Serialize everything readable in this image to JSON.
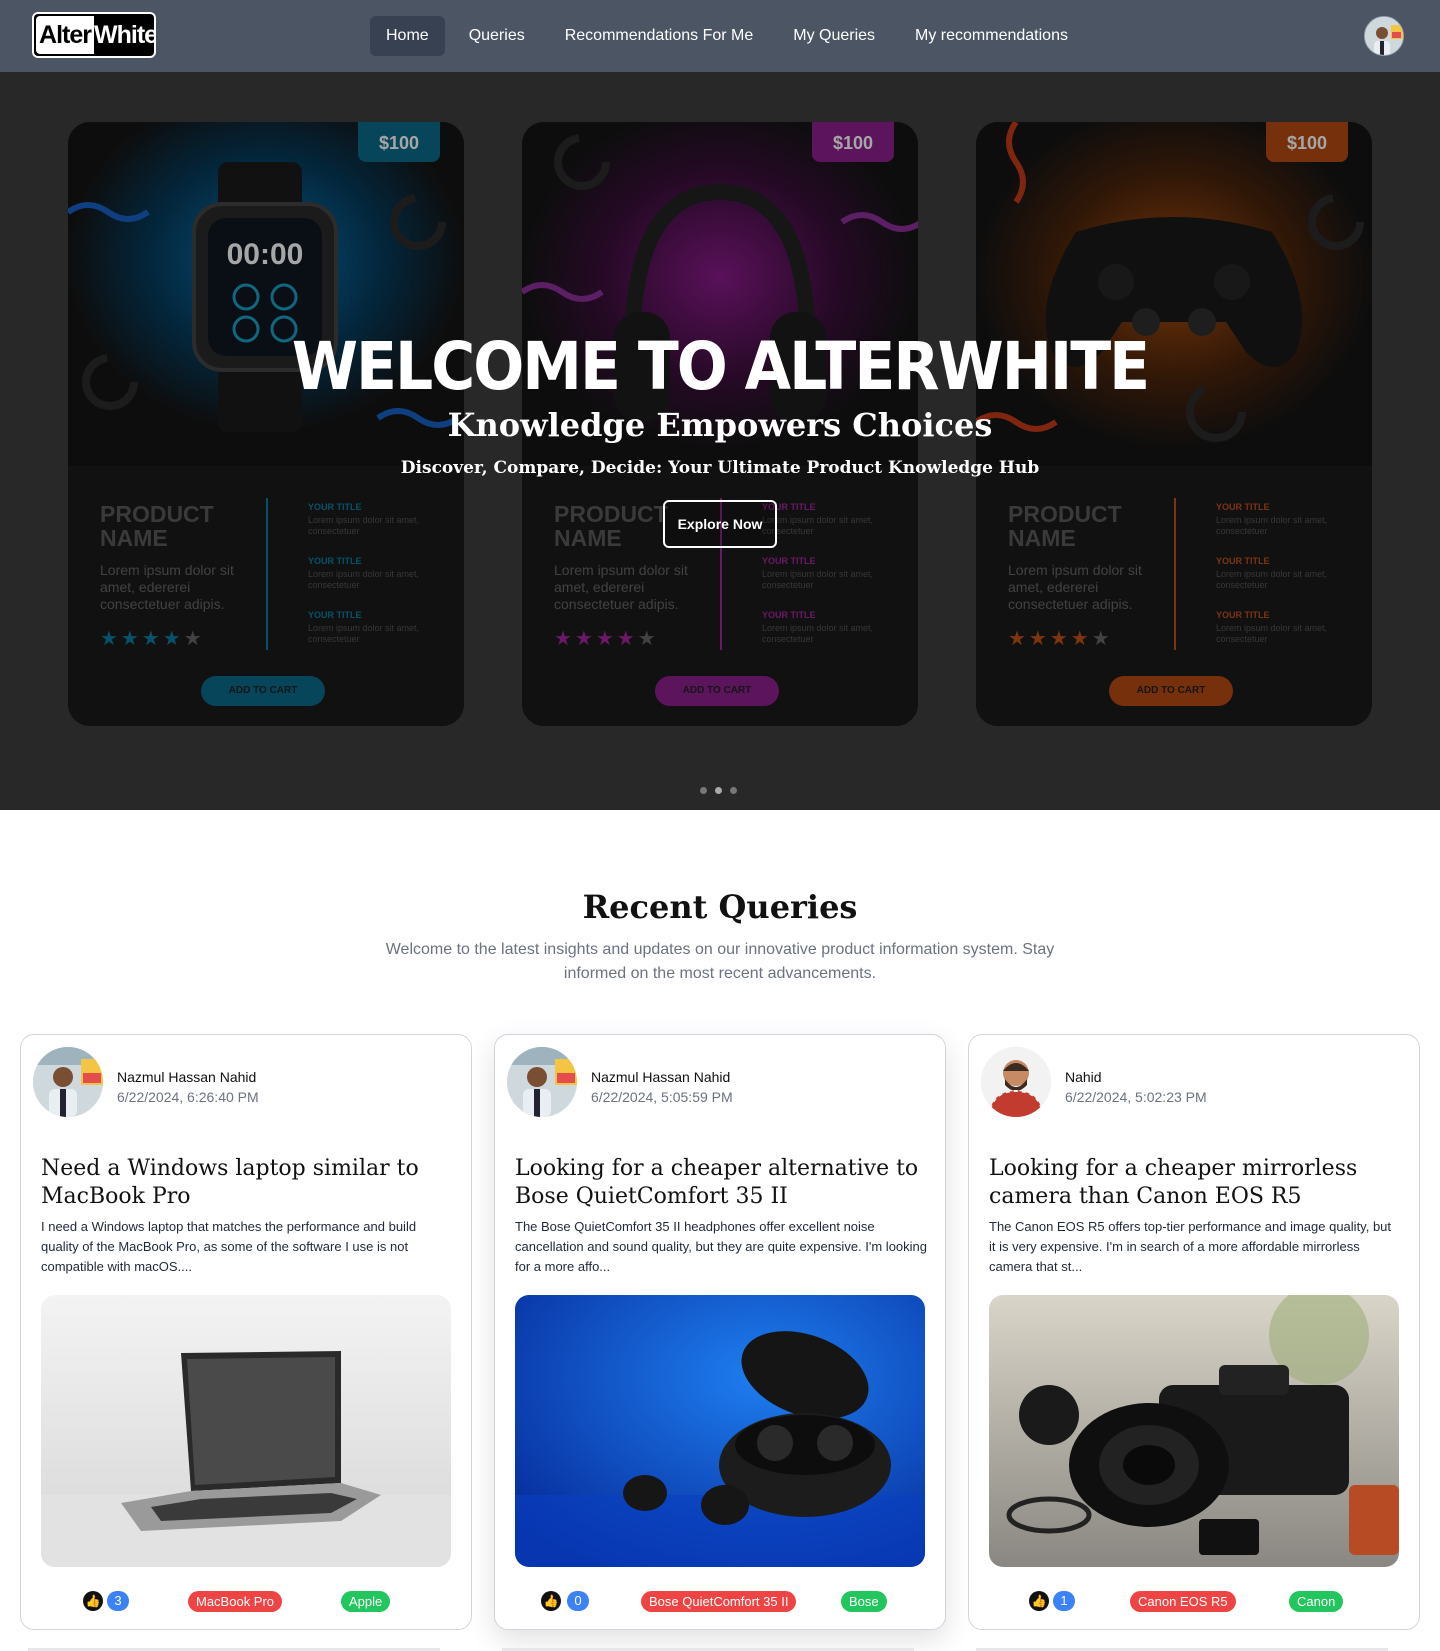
{
  "brand": {
    "logo_left": "Alter",
    "logo_right": "White"
  },
  "nav": {
    "items": [
      {
        "label": "Home",
        "active": true
      },
      {
        "label": "Queries"
      },
      {
        "label": "Recommendations For Me"
      },
      {
        "label": "My Queries"
      },
      {
        "label": "My recommendations"
      }
    ]
  },
  "hero": {
    "title": "WELCOME TO ALTERWHITE",
    "subtitle": "Knowledge Empowers Choices",
    "tagline": "Discover, Compare, Decide: Your Ultimate Product Knowledge Hub",
    "cta": "Explore Now",
    "slides": {
      "count": 3,
      "active_index": 1
    },
    "cards": [
      {
        "price": "$100",
        "accent": "#0b6b8c",
        "name": "PRODUCT NAME",
        "desc": "Lorem ipsum dolor sit amet, edererei consectetuer adipis.",
        "features": [
          {
            "title": "YOUR TITLE",
            "text": "Lorem ipsum dolor sit amet, consectetuer"
          },
          {
            "title": "YOUR TITLE",
            "text": "Lorem ipsum dolor sit amet, consectetuer"
          },
          {
            "title": "YOUR TITLE",
            "text": "Lorem ipsum dolor sit amet, consectetuer"
          }
        ],
        "stars": "★★★★",
        "star_off": "★",
        "button": "ADD TO CART",
        "image_icon": "smartwatch-icon"
      },
      {
        "price": "$100",
        "accent": "#8e1f8e",
        "name": "PRODUCT NAME",
        "desc": "Lorem ipsum dolor sit amet, edererei consectetuer adipis.",
        "features": [
          {
            "title": "YOUR TITLE",
            "text": "Lorem ipsum dolor sit amet, consectetuer"
          },
          {
            "title": "YOUR TITLE",
            "text": "Lorem ipsum dolor sit amet, consectetuer"
          },
          {
            "title": "YOUR TITLE",
            "text": "Lorem ipsum dolor sit amet, consectetuer"
          }
        ],
        "stars": "★★★★",
        "star_off": "★",
        "button": "ADD TO CART",
        "image_icon": "headphones-icon"
      },
      {
        "price": "$100",
        "accent": "#b54a12",
        "name": "PRODUCT NAME",
        "desc": "Lorem ipsum dolor sit amet, edererei consectetuer adipis.",
        "features": [
          {
            "title": "YOUR TITLE",
            "text": "Lorem ipsum dolor sit amet, consectetuer"
          },
          {
            "title": "YOUR TITLE",
            "text": "Lorem ipsum dolor sit amet, consectetuer"
          },
          {
            "title": "YOUR TITLE",
            "text": "Lorem ipsum dolor sit amet, consectetuer"
          }
        ],
        "stars": "★★★★",
        "star_off": "★",
        "button": "ADD TO CART",
        "image_icon": "gamepad-icon"
      }
    ]
  },
  "recent": {
    "title": "Recent Queries",
    "description": "Welcome to the latest insights and updates on our innovative product information system. Stay informed on the most recent advancements.",
    "cards": [
      {
        "author": "Nazmul Hassan Nahid",
        "date": "6/22/2024, 6:26:40 PM",
        "title": "Need a Windows laptop similar to MacBook Pro",
        "text": "I need a Windows laptop that matches the performance and build quality of the MacBook Pro, as some of the software I use is not compatible with macOS....",
        "image_icon": "laptop-image",
        "likes": "3",
        "product_tag": "MacBook Pro",
        "brand_tag": "Apple"
      },
      {
        "author": "Nazmul Hassan Nahid",
        "date": "6/22/2024, 5:05:59 PM",
        "title": "Looking for a cheaper alternative to Bose QuietComfort 35 II",
        "text": "The Bose QuietComfort 35 II headphones offer excellent noise cancellation and sound quality, but they are quite expensive. I'm looking for a more affo...",
        "image_icon": "earbuds-image",
        "likes": "0",
        "product_tag": "Bose QuietComfort 35 II",
        "brand_tag": "Bose"
      },
      {
        "author": "Nahid",
        "date": "6/22/2024, 5:02:23 PM",
        "title": "Looking for a cheaper mirrorless camera than Canon EOS R5",
        "text": "The Canon EOS R5 offers top-tier performance and image quality, but it is very expensive. I'm in search of a more affordable mirrorless camera that st...",
        "image_icon": "camera-image",
        "likes": "1",
        "product_tag": "Canon EOS R5",
        "brand_tag": "Canon"
      }
    ]
  }
}
